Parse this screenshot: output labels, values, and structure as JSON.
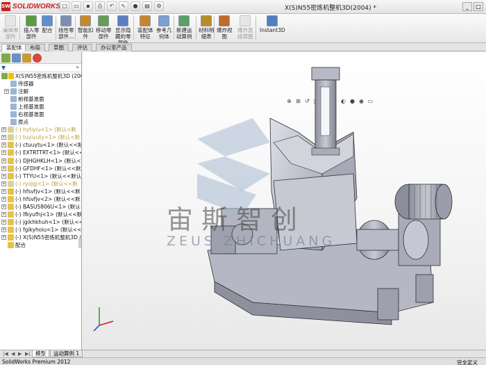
{
  "app": {
    "logo_text": "SOLIDWORKS",
    "window_title": "X(S)N55密炼机整机3D(2004) *"
  },
  "ribbon": {
    "buttons": [
      {
        "label": "编辑零\n部件",
        "disabled": true
      },
      {
        "label": "插入零\n部件",
        "disabled": false
      },
      {
        "label": "配合",
        "disabled": false
      },
      {
        "label": "线性零\n部件...",
        "disabled": false
      },
      {
        "label": "智能扣\n件",
        "disabled": false
      },
      {
        "label": "移动零\n部件",
        "disabled": false
      },
      {
        "label": "显示隐\n藏的零\n部件",
        "disabled": false
      },
      {
        "label": "装配体\n特征",
        "disabled": false
      },
      {
        "label": "参考几\n何体",
        "disabled": false
      },
      {
        "label": "新建运\n动算例",
        "disabled": false
      },
      {
        "label": "材料明\n细表",
        "disabled": false
      },
      {
        "label": "爆炸视\n图",
        "disabled": false
      },
      {
        "label": "爆炸直\n线草图",
        "disabled": true
      },
      {
        "label": "Instant3D",
        "disabled": false
      }
    ]
  },
  "command_tabs": [
    "装配体",
    "布局",
    "草图",
    "评估",
    "办公室产品"
  ],
  "feature_tree": {
    "root": "X(S)N55密炼机整机3D (2004) (",
    "items": [
      {
        "label": "传感器",
        "indent": 1,
        "expander": false
      },
      {
        "label": "注解",
        "indent": 1,
        "expander": true
      },
      {
        "label": "前视基准面",
        "indent": 1,
        "expander": false
      },
      {
        "label": "上视基准面",
        "indent": 1,
        "expander": false
      },
      {
        "label": "右视基准面",
        "indent": 1,
        "expander": false
      },
      {
        "label": "原点",
        "indent": 1,
        "expander": false
      },
      {
        "label": "(-) hytiyiu<1> (默认<默",
        "indent": 0,
        "expander": true,
        "grey": true
      },
      {
        "label": "(-) tuyiyuty<1> (默认<默",
        "indent": 0,
        "expander": true,
        "grey": true
      },
      {
        "label": "(-) ctuuytu<1> (默认<<默认",
        "indent": 0,
        "expander": true
      },
      {
        "label": "(-) EXTRTTRT<1> (默认<<默",
        "indent": 0,
        "expander": true
      },
      {
        "label": "(-) DJHGHKLH<1> (默认<<默",
        "indent": 0,
        "expander": true
      },
      {
        "label": "(-) GFDHF<1> (默认<<默认>",
        "indent": 0,
        "expander": true
      },
      {
        "label": "(-) TTYU<1> (默认<<默认>",
        "indent": 0,
        "expander": true
      },
      {
        "label": "(-) ryojgj<1> (默认<<默",
        "indent": 0,
        "expander": true,
        "grey": true
      },
      {
        "label": "(-) hfsvfjv<1> (默认<<默",
        "indent": 0,
        "expander": true
      },
      {
        "label": "(-) hfsvfjv<2> (默认<<默",
        "indent": 0,
        "expander": true
      },
      {
        "label": "(-) BASU5806U<1> (默认<<",
        "indent": 0,
        "expander": true
      },
      {
        "label": "(-) lfkyufhj<1> (默认<<默",
        "indent": 0,
        "expander": true
      },
      {
        "label": "(-) jgikhkhuh<1> (默认<<默",
        "indent": 0,
        "expander": true
      },
      {
        "label": "(-) fgikyhoiu<1> (默认<<默",
        "indent": 0,
        "expander": true
      },
      {
        "label": "(-) X(S)N55密炼机整机3D (2",
        "indent": 0,
        "expander": true
      },
      {
        "label": "配合",
        "indent": 0,
        "expander": false
      }
    ]
  },
  "watermark": {
    "cn": "宙斯智创",
    "en": "ZEUS ZHICHUANG"
  },
  "bottom_tabs": [
    "模型",
    "运动算例 1"
  ],
  "status": {
    "left": "SolidWorks Premium 2012",
    "right": "完全定义"
  },
  "colors": {
    "brand": "#c8201f",
    "model_grey": "#c3c5d0",
    "watermark_blue": "#a6bad0"
  }
}
